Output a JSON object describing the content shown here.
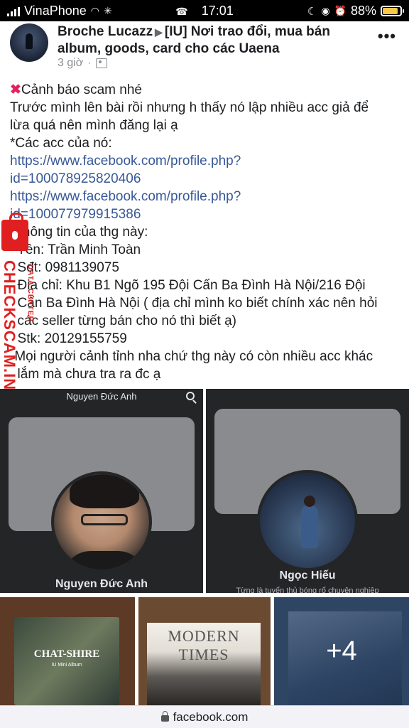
{
  "status_bar": {
    "carrier": "VinaPhone",
    "time": "17:01",
    "battery": "88%",
    "battery_level": 0.88
  },
  "post": {
    "author": "Broche Lucazz",
    "group": "[IU] Nơi trao đổi, mua bán album, goods, card cho các Uaena",
    "time": "3 giờ",
    "lines": [
      {
        "text": "Cảnh báo scam nhé",
        "link": false
      },
      {
        "text": "Trước mình lên bài rồi nhưng h thấy nó lập nhiều acc giả để",
        "link": false
      },
      {
        "text": "lừa quá nên mình đăng lại ạ",
        "link": false
      },
      {
        "text": "*Các acc của nó:",
        "link": false
      },
      {
        "text": "https://www.facebook.com/profile.php?",
        "link": true
      },
      {
        "text": "id=100078925820406",
        "link": true
      },
      {
        "text": "https://www.facebook.com/profile.php?",
        "link": true
      },
      {
        "text": "id=100077979915386",
        "link": true
      },
      {
        "text": "-Thông tin của thg này:",
        "link": false
      },
      {
        "text": "  Tên: Trần Minh Toàn",
        "link": false
      },
      {
        "text": "  Sđt: 0981139075",
        "link": false
      },
      {
        "text": "  Địa chỉ: Khu B1 Ngõ 195 Đội Cấn Ba Đình Hà Nội/216 Đội",
        "link": false
      },
      {
        "text": "  Cấn Ba Đình Hà Nội ( địa chỉ mình ko biết chính xác nên hỏi",
        "link": false
      },
      {
        "text": "  các seller từng bán cho nó thì biết ạ)",
        "link": false
      },
      {
        "text": "  Stk: 20129155759",
        "link": false
      },
      {
        "text": "-Mọi người cảnh tỉnh nha chứ thg này có còn nhiều acc khác",
        "link": false
      },
      {
        "text": "  lắm mà chưa tra ra đc ạ",
        "link": false
      }
    ]
  },
  "watermark": {
    "text": "CHECKSCAM.INFO",
    "sub": "DATA CENTER"
  },
  "screenshots": [
    {
      "header_name": "Nguyen Đức Anh",
      "profile_name": "Nguyen Đức Anh",
      "subtitle": ""
    },
    {
      "header_name": "Ngọc Hiếu",
      "profile_name": "Ngọc Hiếu",
      "subtitle": "Từng là tuyển thủ bóng rổ chuyên nghiệp"
    }
  ],
  "photos": [
    {
      "album_title": "CHAT-SHIRE",
      "album_sub": "IU Mini Album"
    },
    {
      "album_title": "MODERN TIMES"
    },
    {
      "more_count": "+4"
    }
  ],
  "browser": {
    "url": "facebook.com"
  }
}
